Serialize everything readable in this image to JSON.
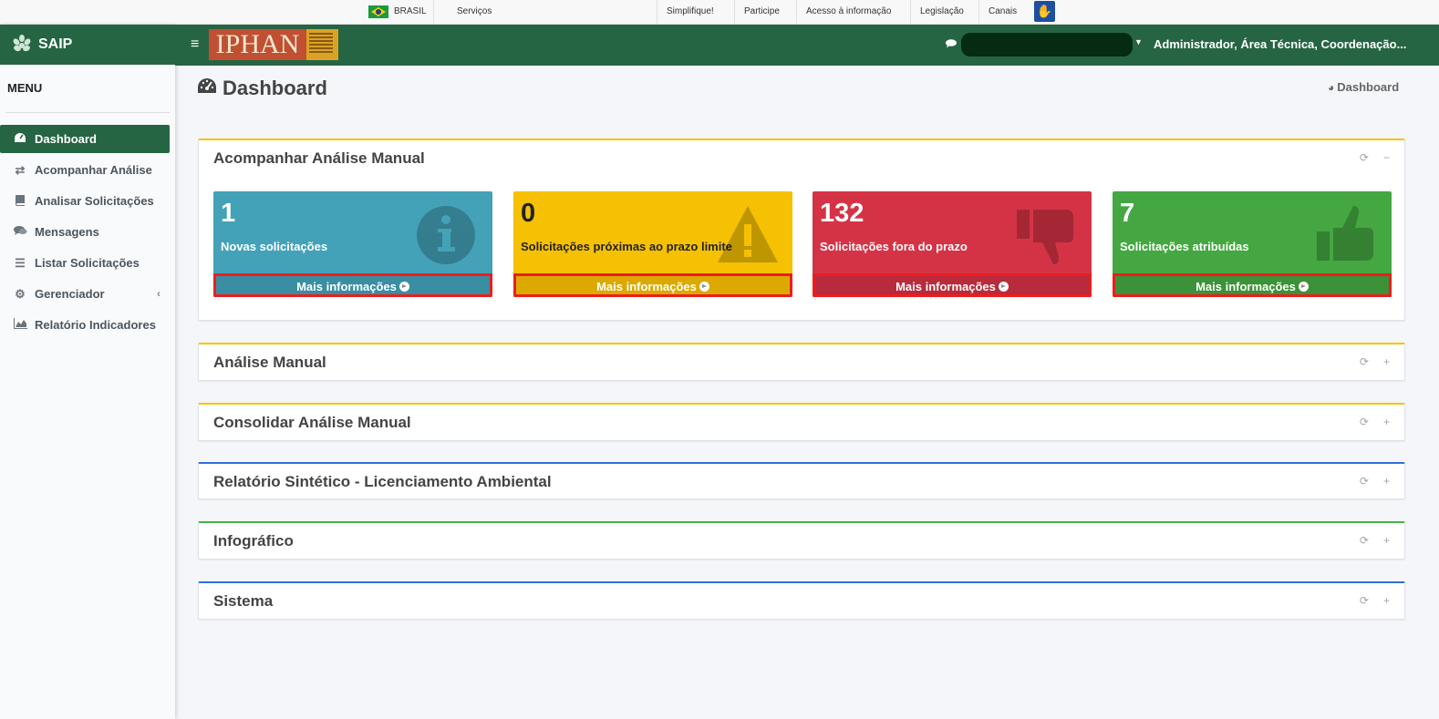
{
  "govbar": {
    "country": "BRASIL",
    "links": [
      "Serviços",
      "Simplifique!",
      "Participe",
      "Acesso à informação",
      "Legislação",
      "Canais"
    ]
  },
  "sidebar": {
    "brand": "SAIP",
    "menu_title": "MENU",
    "items": [
      {
        "label": "Dashboard",
        "icon": "dashboard-icon",
        "active": true
      },
      {
        "label": "Acompanhar Análise",
        "icon": "exchange-icon"
      },
      {
        "label": "Analisar Solicitações",
        "icon": "book-icon"
      },
      {
        "label": "Mensagens",
        "icon": "comments-icon"
      },
      {
        "label": "Listar Solicitações",
        "icon": "list-icon"
      },
      {
        "label": "Gerenciador",
        "icon": "gears-icon",
        "has_submenu": true
      },
      {
        "label": "Relatório Indicadores",
        "icon": "area-chart-icon"
      }
    ]
  },
  "header": {
    "logo_text": "IPHAN",
    "user": "Administrador, Área Técnica, Coordenação..."
  },
  "page": {
    "title": "Dashboard",
    "breadcrumb": "Dashboard"
  },
  "boxes": {
    "acompanhar": {
      "title": "Acompanhar Análise Manual",
      "tiles": [
        {
          "value": "1",
          "label": "Novas solicitações",
          "link": "Mais informações",
          "icon": "info-icon",
          "color": "#44a2b8"
        },
        {
          "value": "0",
          "label": "Solicitações próximas ao prazo limite",
          "link": "Mais informações",
          "icon": "warning-icon",
          "color": "#f5c102"
        },
        {
          "value": "132",
          "label": "Solicitações fora do prazo",
          "link": "Mais informações",
          "icon": "thumbs-down-icon",
          "color": "#d43346"
        },
        {
          "value": "7",
          "label": "Solicitações atribuídas",
          "link": "Mais informações",
          "icon": "thumbs-up-icon",
          "color": "#45a741"
        }
      ]
    },
    "analise_manual": {
      "title": "Análise Manual"
    },
    "consolidar": {
      "title": "Consolidar Análise Manual"
    },
    "relatorio": {
      "title": "Relatório Sintético - Licenciamento Ambiental"
    },
    "infografico": {
      "title": "Infográfico"
    },
    "sistema": {
      "title": "Sistema"
    }
  },
  "colors": {
    "brand_green": "#266543",
    "accent_yellow": "#f3c400",
    "accent_blue": "#2f6fd6",
    "accent_green": "#45b445"
  }
}
